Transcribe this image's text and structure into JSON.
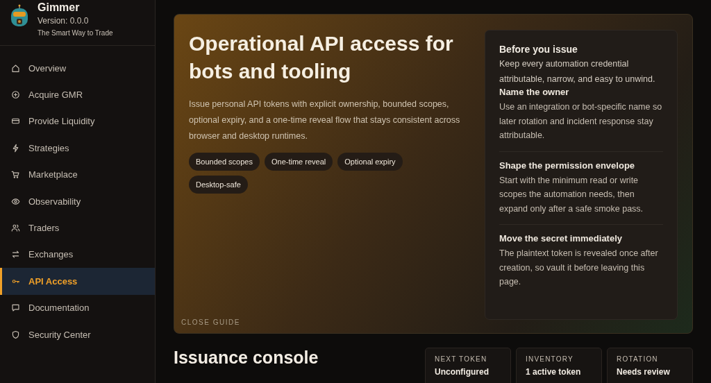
{
  "brand": {
    "name": "Gimmer",
    "version": "Version: 0.0.0",
    "tagline": "The Smart Way to Trade"
  },
  "nav": [
    {
      "label": "Overview",
      "selected": false
    },
    {
      "label": "Acquire GMR",
      "selected": false
    },
    {
      "label": "Provide Liquidity",
      "selected": false
    },
    {
      "label": "Strategies",
      "selected": false
    },
    {
      "label": "Marketplace",
      "selected": false
    },
    {
      "label": "Observability",
      "selected": false
    },
    {
      "label": "Traders",
      "selected": false
    },
    {
      "label": "Exchanges",
      "selected": false
    },
    {
      "label": "API Access",
      "selected": true
    },
    {
      "label": "Documentation",
      "selected": false
    },
    {
      "label": "Security Center",
      "selected": false
    }
  ],
  "hero": {
    "title": "Operational API access for bots and tooling",
    "description": "Issue personal API tokens with explicit ownership, bounded scopes, optional expiry, and a one-time reveal flow that stays consistent across browser and desktop runtimes.",
    "chips": [
      "Bounded scopes",
      "One-time reveal",
      "Optional expiry",
      "Desktop-safe"
    ],
    "close_button": "CLOSE GUIDE",
    "guide": {
      "title": "Before you issue",
      "intro": "Keep every automation credential attributable, narrow, and easy to unwind.",
      "steps": [
        {
          "title": "Name the owner",
          "text": "Use an integration or bot-specific name so later rotation and incident response stay attributable."
        },
        {
          "title": "Shape the permission envelope",
          "text": "Start with the minimum read or write scopes the automation needs, then expand only after a safe smoke pass."
        },
        {
          "title": "Move the secret immediately",
          "text": "The plaintext token is revealed once after creation, so vault it before leaving this page."
        }
      ]
    }
  },
  "console": {
    "title": "Issuance console",
    "stats": [
      {
        "label": "NEXT TOKEN",
        "value": "Unconfigured"
      },
      {
        "label": "INVENTORY",
        "value": "1 active token"
      },
      {
        "label": "ROTATION",
        "value": "Needs review"
      }
    ]
  }
}
